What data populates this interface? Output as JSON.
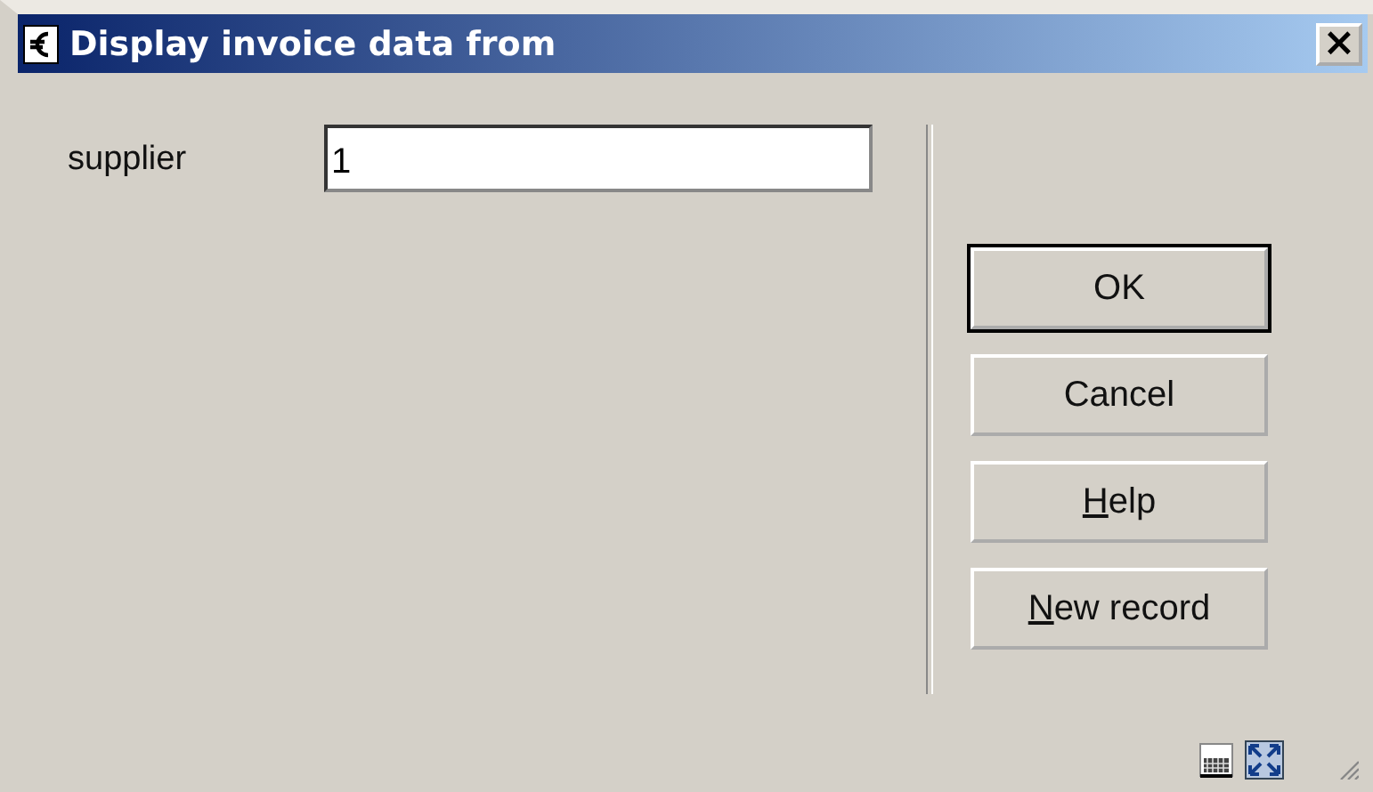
{
  "window": {
    "title": "Display invoice data from",
    "close": "×"
  },
  "form": {
    "label": "supplier",
    "value": "1"
  },
  "buttons": [
    {
      "rest": "OK",
      "default": true
    },
    {
      "rest": "Cancel",
      "default": false
    },
    {
      "underlined": "H",
      "rest": "elp",
      "default": false
    },
    {
      "underlined": "N",
      "rest": "ew record",
      "default": false
    }
  ]
}
